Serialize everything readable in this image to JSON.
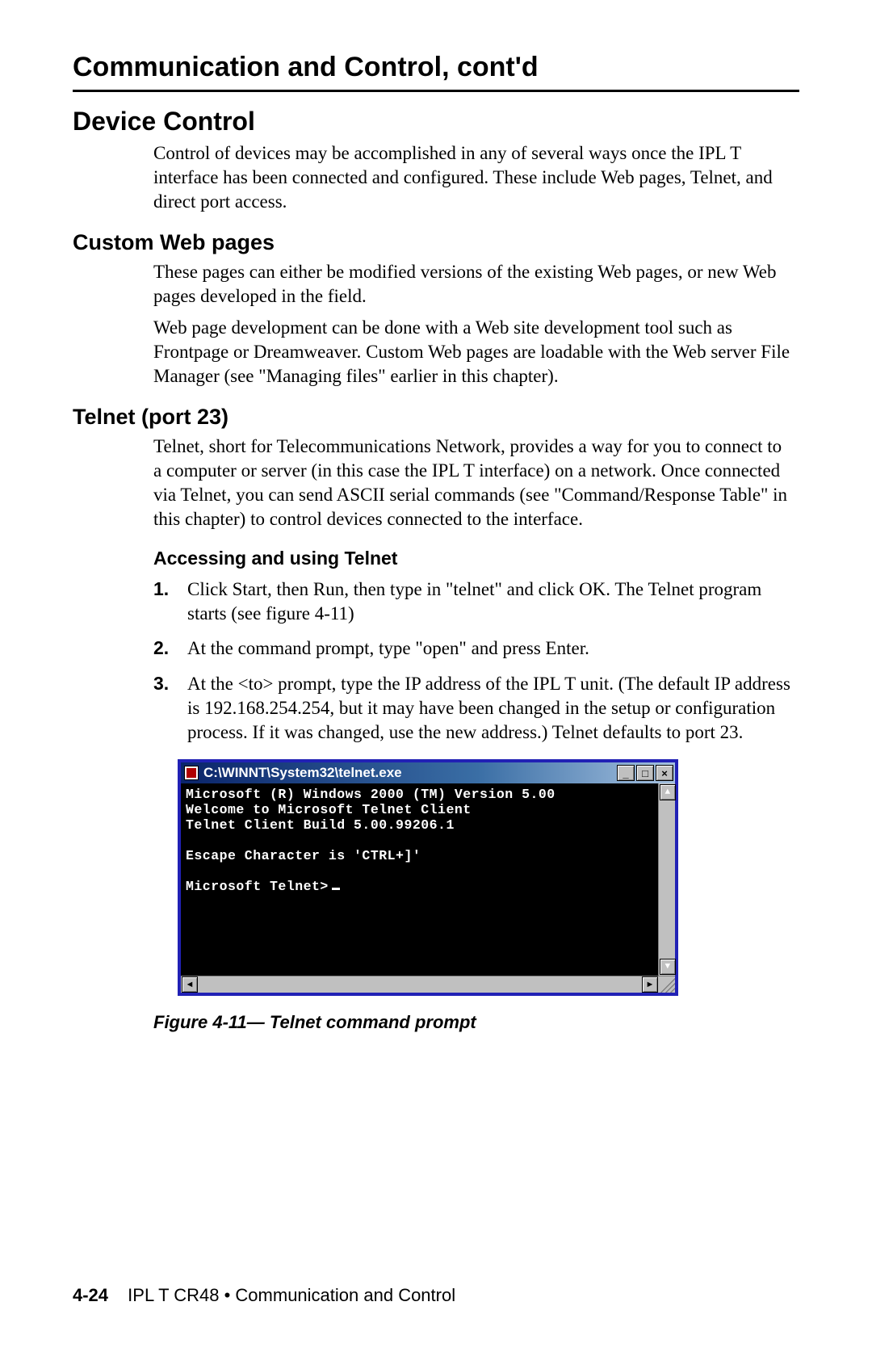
{
  "section_title": "Communication and Control, cont'd",
  "h1": "Device Control",
  "intro": "Control of devices may be accomplished in any of several ways once the IPL T interface has been connected and configured. These include Web pages, Telnet, and direct port access.",
  "custom_web": {
    "heading": "Custom Web pages",
    "p1": "These pages can either be modified versions of the existing Web pages, or new Web pages developed in the field.",
    "p2": "Web page development can be done with a Web site development tool such as Frontpage or Dreamweaver.  Custom Web pages are loadable with the Web server File Manager (see \"Managing files\" earlier in this chapter)."
  },
  "telnet": {
    "heading": "Telnet (port 23)",
    "p1": "Telnet, short for Telecommunications Network, provides a way for you to connect to a computer or server (in this case the IPL T interface) on a network.  Once connected via Telnet, you can send ASCII serial commands (see \"Command/Response Table\" in this chapter) to control devices connected to the interface.",
    "sub_heading": "Accessing and using Telnet",
    "steps": [
      {
        "n": "1.",
        "t": "Click Start, then Run, then type in \"telnet\" and click OK. The Telnet program starts (see figure 4-11)"
      },
      {
        "n": "2.",
        "t": "At the command prompt, type \"open\" and press Enter."
      },
      {
        "n": "3.",
        "t": "At the <to> prompt, type the IP address of the IPL T unit. (The default IP address is 192.168.254.254, but it may have been changed in the setup or configuration process.  If it was changed, use the new address.)  Telnet defaults to port 23."
      }
    ]
  },
  "window": {
    "title": "C:\\WINNT\\System32\\telnet.exe",
    "buttons": {
      "min": "_",
      "max": "□",
      "close": "×"
    },
    "lines": [
      "Microsoft (R) Windows 2000 (TM) Version 5.00",
      "Welcome to Microsoft Telnet Client",
      "Telnet Client Build 5.00.99206.1",
      "",
      "Escape Character is 'CTRL+]'",
      "",
      "Microsoft Telnet>"
    ],
    "scroll": {
      "up": "▲",
      "down": "▼",
      "left": "◄",
      "right": "►"
    }
  },
  "figure_caption": "Figure 4-11— Telnet command prompt",
  "footer": {
    "page": "4-24",
    "text": "IPL T CR48 • Communication and Control"
  }
}
